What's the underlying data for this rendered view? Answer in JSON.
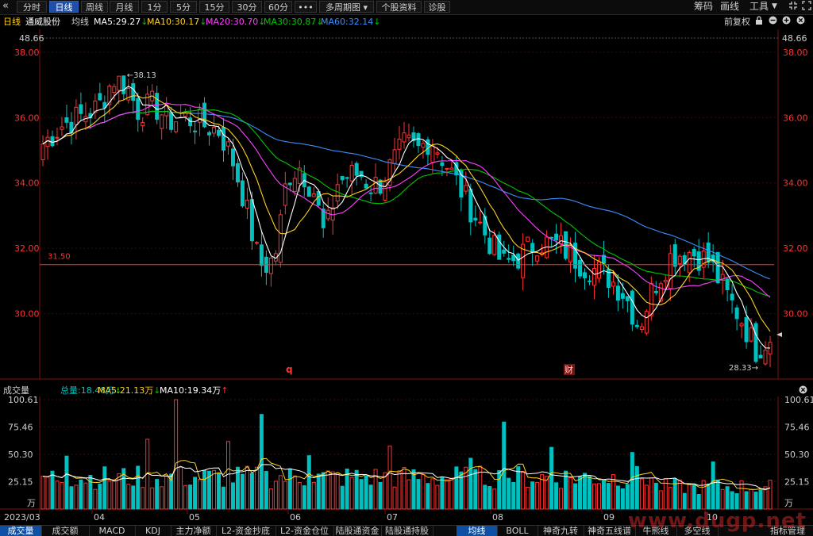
{
  "toolbar": {
    "collapse_icon": "double-chevron-left-icon",
    "tabs": [
      "分时",
      "日线",
      "周线",
      "月线",
      "1分",
      "5分",
      "15分",
      "30分",
      "60分",
      "•••",
      "多周期图",
      "个股资料",
      "诊股"
    ],
    "active_tab": "日线",
    "right_items": [
      "筹码",
      "画线",
      "工具"
    ],
    "right_icons": [
      "fullscreen-shrink-icon",
      "fullscreen-expand-icon"
    ]
  },
  "infobar": {
    "period": "日线",
    "stock_name": "通威股份",
    "avg_label": "均线",
    "ma5": "MA5:29.27",
    "ma10": "MA10:30.17",
    "ma20": "MA20:30.70",
    "ma30": "MA30:30.87",
    "ma60": "MA60:32.14",
    "adjust": "前复权"
  },
  "colors": {
    "up": "#ff3232",
    "down": "#00c0c0",
    "ma5": "#ffffff",
    "ma10": "#ffd21e",
    "ma20": "#ff40ff",
    "ma30": "#00c800",
    "ma60": "#3a8fff",
    "axis_red": "#ff3232",
    "vol_ma5": "#ffd21e",
    "vol_ma10": "#ffffff",
    "grid": "#7a1010"
  },
  "chart_data": [
    {
      "type": "candlestick",
      "title": "通威股份 日线",
      "ylim": [
        28.0,
        38.7
      ],
      "y_ticks": [
        "38.00",
        "36.00",
        "34.00",
        "32.00",
        "30.00"
      ],
      "top_value": "48.66",
      "x_ticks": [
        "2023/03",
        "04",
        "05",
        "06",
        "07",
        "08",
        "09",
        "10"
      ],
      "horizontal_line": {
        "value": 31.5,
        "label": "31.50"
      },
      "annotations": {
        "max_label": "38.13",
        "min_label": "28.33",
        "marker_q": "q",
        "marker_cai": "财"
      },
      "series_names": [
        "MA5",
        "MA10",
        "MA20",
        "MA30",
        "MA60"
      ],
      "ma_last": {
        "MA5": 29.27,
        "MA10": 30.17,
        "MA20": 30.7,
        "MA30": 30.87,
        "MA60": 32.14
      }
    },
    {
      "type": "bar",
      "title": "成交量",
      "unit": "万",
      "y_ticks": [
        "100.61",
        "75.46",
        "50.30",
        "25.15"
      ],
      "ylim": [
        0,
        100.61
      ],
      "legend": {
        "total": "总量:18.48万",
        "ma5": "MA5:21.13万",
        "ma10": "MA10:19.34万"
      }
    }
  ],
  "volume_header": {
    "title": "成交量",
    "total": "总量:18.48万",
    "ma5": "MA5:21.13万",
    "ma10": "MA10:19.34万",
    "unit": "万"
  },
  "bottombar": {
    "tabs": [
      "成交量",
      "成交额",
      "MACD",
      "KDJ",
      "主力净额",
      "L2-资金抄底",
      "L2-资金仓位",
      "陆股通资金",
      "陆股通持股",
      "均线",
      "BOLL",
      "神奇九转",
      "神奇五线谱",
      "牛熊线",
      "多空线",
      "指标管理"
    ],
    "active_left": "成交量",
    "active_right": "均线"
  },
  "watermark": "www.dugp.net"
}
